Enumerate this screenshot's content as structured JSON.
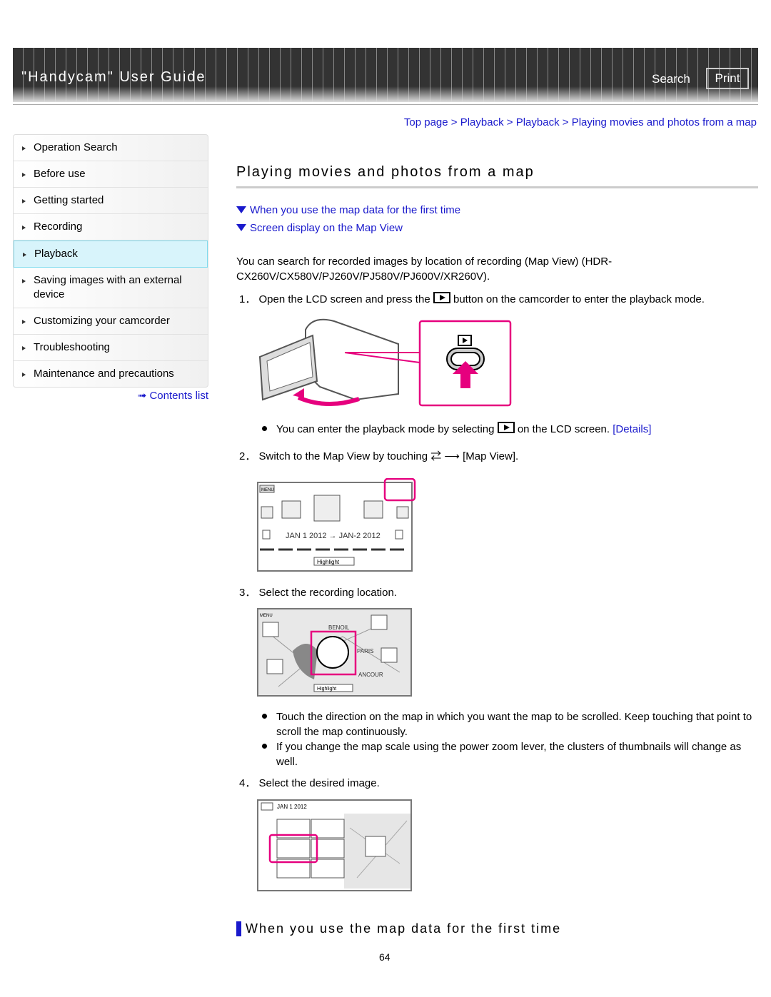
{
  "header": {
    "title": "\"Handycam\" User Guide",
    "search": "Search",
    "print": "Print"
  },
  "breadcrumb": [
    "Top page",
    "Playback",
    "Playback",
    "Playing movies and photos from a map"
  ],
  "sidebar": {
    "items": [
      "Operation Search",
      "Before use",
      "Getting started",
      "Recording",
      "Playback",
      "Saving images with an external device",
      "Customizing your camcorder",
      "Troubleshooting",
      "Maintenance and precautions"
    ],
    "contents": "Contents list"
  },
  "main": {
    "title": "Playing movies and photos from a map",
    "links": [
      "When you use the map data for the first time",
      "Screen display on the Map View"
    ],
    "intro": "You can search for recorded images by location of recording (Map View) (HDR-CX260V/CX580V/PJ260V/PJ580V/PJ600V/XR260V).",
    "step1": {
      "num": "1．",
      "pre": "Open the LCD screen and press the",
      "post": "button on the camcorder to enter the playback mode."
    },
    "bullet1": {
      "pre": "You can enter the playback mode by selecting",
      "post": "on the LCD screen.",
      "link": "[Details]"
    },
    "step2": {
      "num": "2．",
      "pre": "Switch to the Map View by touching",
      "post": "[Map View]."
    },
    "step3": {
      "num": "3．",
      "text": "Select the recording location."
    },
    "bullets3": [
      "Touch the direction on the map in which you want the map to be scrolled. Keep touching that point to scroll the map continuously.",
      "If you change the map scale using the power zoom lever, the clusters of thumbnails will change as well."
    ],
    "step4": {
      "num": "4．",
      "text": "Select the desired image."
    },
    "section2": "When you use the map data for the first time",
    "page": "64"
  },
  "screens": {
    "menu": "MENU",
    "daterange": "JAN 1 2012 → JAN-2 2012",
    "highlight": "Highlight",
    "date4": "JAN 1 2012",
    "places": [
      "BENOIL",
      "PARIS",
      "ANCOUR"
    ]
  },
  "colors": {
    "accent": "#e6007e",
    "link": "#1a1acc"
  }
}
